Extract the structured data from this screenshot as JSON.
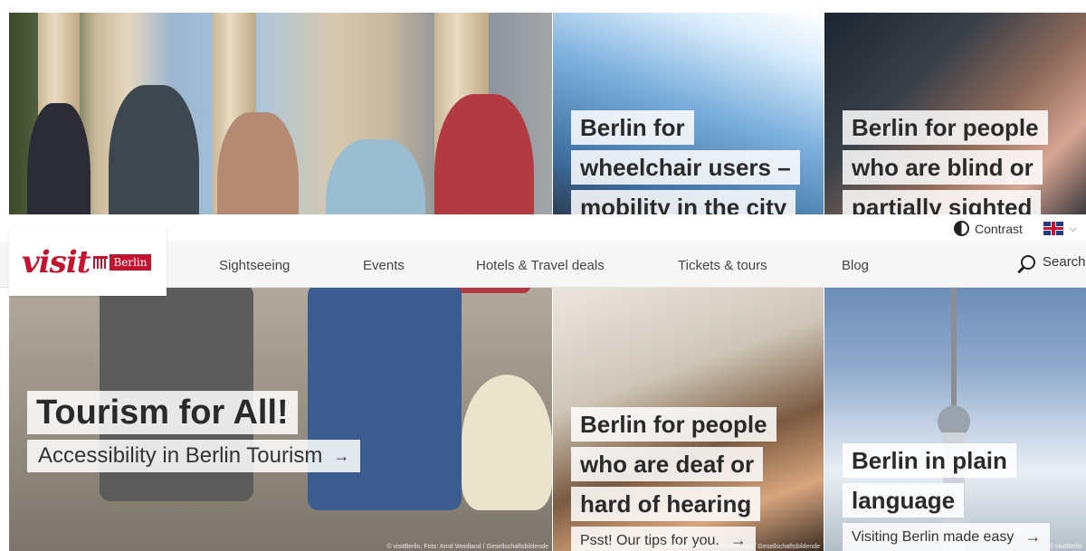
{
  "hero": {
    "title": "Tourism for All!",
    "subtitle": "Accessibility in Berlin Tourism",
    "arrow": "→",
    "credit": "© visitBerlin, Foto: Arnd Weidland / Gesellschaftsbildende"
  },
  "tiles": [
    {
      "id": "wheelchair",
      "lines": [
        "Berlin for",
        "wheelchair users –",
        "mobility in the city"
      ]
    },
    {
      "id": "blind",
      "lines": [
        "Berlin for people",
        "who are blind or",
        "partially sighted"
      ]
    },
    {
      "id": "deaf",
      "lines": [
        "Berlin for people",
        "who are deaf or",
        "hard of hearing"
      ],
      "sub": "Psst! Our tips for you.",
      "arrow": "→",
      "credit": "© visitBerlin, Foto: Arnd Weidland / Gesellschaftsbildende"
    },
    {
      "id": "plain",
      "lines": [
        "Berlin in plain",
        "language"
      ],
      "sub": "Visiting Berlin made easy",
      "arrow": "→",
      "credit": "© visitBerlin"
    }
  ],
  "controls": {
    "contrast_label": "Contrast",
    "language_icon": "uk-flag-icon",
    "chevron": "⌵"
  },
  "logo": {
    "visit": "visit",
    "berlin": "Berlin"
  },
  "nav": {
    "items": [
      "Sightseeing",
      "Events",
      "Hotels & Travel deals",
      "Tickets & tours",
      "Blog"
    ],
    "search_label": "Search"
  },
  "colors": {
    "brand_red": "#c4122f",
    "caption_bg": "rgba(255,255,255,0.86)"
  }
}
